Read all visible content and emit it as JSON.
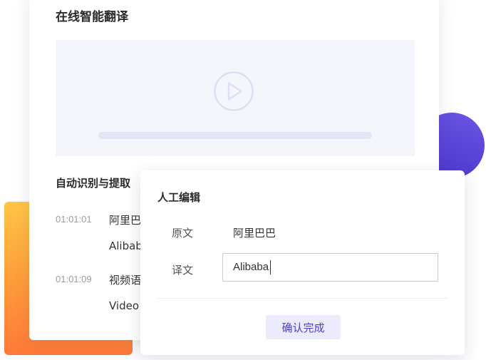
{
  "video_panel": {
    "title": "在线智能翻译",
    "progress": 1.0
  },
  "subtitles": {
    "section_title": "自动识别与提取",
    "items": [
      {
        "time": "01:01:01",
        "original": "阿里巴",
        "translation": "Alibab"
      },
      {
        "time": "01:01:09",
        "original": "视频语",
        "translation": "Video"
      }
    ]
  },
  "edit_dialog": {
    "title": "人工编辑",
    "original_label": "原文",
    "original_value": "阿里巴巴",
    "translation_label": "译文",
    "translation_value": "Alibaba",
    "confirm_label": "确认完成"
  },
  "colors": {
    "accent": "#4b3fd0",
    "accent_bg": "#ebebfb",
    "deco_orange": "#ff9a3a",
    "deco_purple": "#5a44d8"
  }
}
